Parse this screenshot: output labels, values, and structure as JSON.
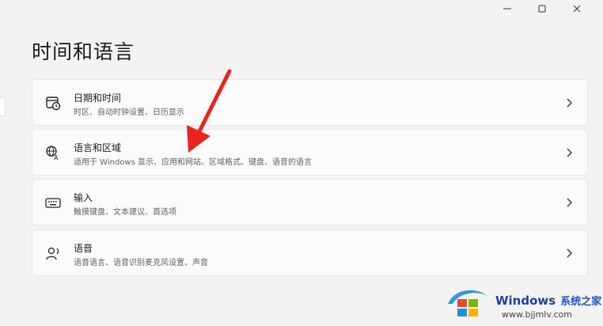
{
  "window": {
    "minimize_glyph": "—",
    "maximize_glyph": "☐",
    "close_glyph": "✕"
  },
  "page": {
    "title": "时间和语言"
  },
  "cards": [
    {
      "icon": "calendar-clock-icon",
      "title": "日期和时间",
      "subtitle": "时区、自动时钟设置、日历显示"
    },
    {
      "icon": "language-region-icon",
      "title": "语言和区域",
      "subtitle": "适用于 Windows 显示、应用和网站、区域格式、键盘、语音的语言"
    },
    {
      "icon": "keyboard-icon",
      "title": "输入",
      "subtitle": "触摸键盘、文本建议、首选项"
    },
    {
      "icon": "speech-icon",
      "title": "语音",
      "subtitle": "语音语言、语音识别麦克风设置、声音"
    }
  ],
  "annotation": {
    "arrow_color": "#e8261f"
  },
  "watermark": {
    "brand": "Windows",
    "site_name": "系统之家",
    "url": "www.bjjmlv.com",
    "colors": [
      "#e84b2a",
      "#7ab800",
      "#1e8fe1",
      "#f4b400"
    ]
  }
}
